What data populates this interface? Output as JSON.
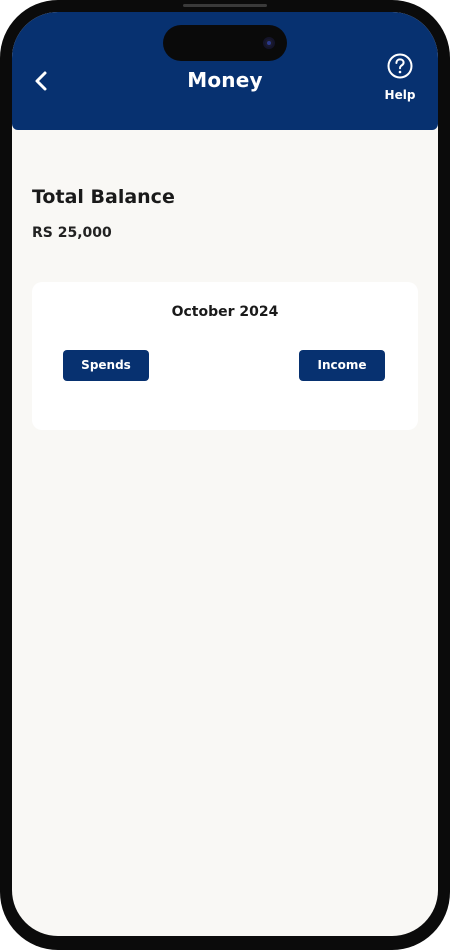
{
  "header": {
    "title": "Money",
    "back_icon": "chevron-left-icon",
    "help_icon": "question-circle-icon",
    "help_label": "Help",
    "color": "#073170"
  },
  "balance": {
    "title": "Total Balance",
    "amount": "RS 25,000"
  },
  "summary": {
    "month": "October 2024",
    "spends_label": "Spends",
    "income_label": "Income"
  },
  "colors": {
    "accent": "#073170",
    "background": "#f9f8f5",
    "card": "#ffffff"
  }
}
